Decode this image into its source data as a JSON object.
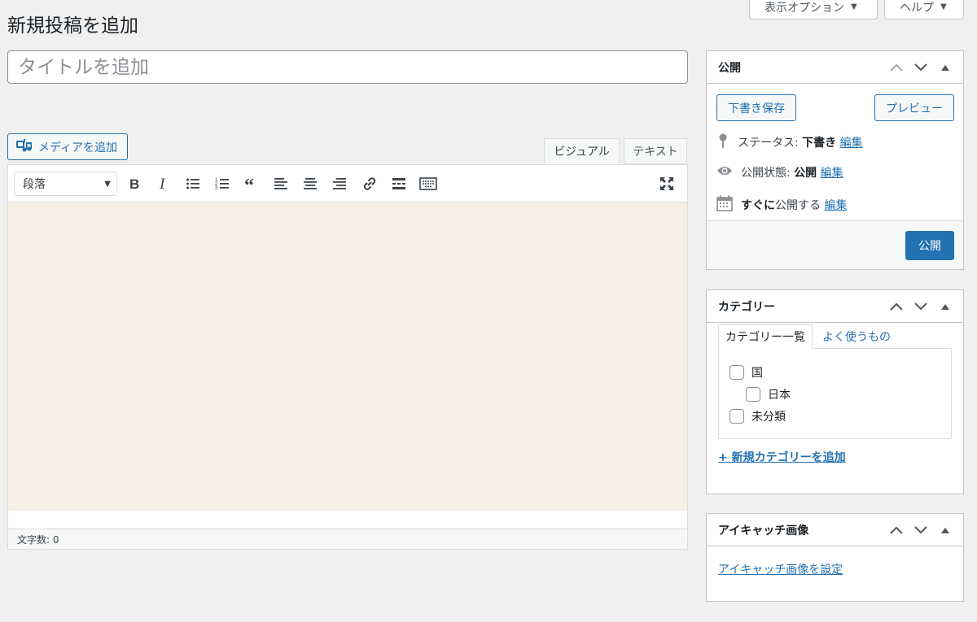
{
  "header": {
    "screen_options_label": "表示オプション",
    "help_label": "ヘルプ",
    "page_title": "新規投稿を追加"
  },
  "title_field": {
    "placeholder": "タイトルを追加"
  },
  "editor": {
    "add_media_label": "メディアを追加",
    "tabs": {
      "visual": "ビジュアル",
      "text": "テキスト"
    },
    "format_select_value": "段落",
    "word_count": "文字数: 0",
    "content_bg": "#f5efe3"
  },
  "publish_box": {
    "title": "公開",
    "save_draft_label": "下書き保存",
    "preview_label": "プレビュー",
    "status_label": "ステータス: ",
    "status_value": "下書き",
    "visibility_label": "公開状態: ",
    "visibility_value": "公開",
    "schedule_bold": "すぐに",
    "schedule_text": "公開する",
    "edit_label": "編集",
    "publish_label": "公開"
  },
  "category_box": {
    "title": "カテゴリー",
    "tab_all": "カテゴリー一覧",
    "tab_popular": "よく使うもの",
    "items": [
      {
        "label": "国",
        "checked": false
      },
      {
        "label": "日本",
        "checked": false
      },
      {
        "label": "未分類",
        "checked": false
      }
    ],
    "add_new_label": "+ 新規カテゴリーを追加"
  },
  "thumbnail_box": {
    "title": "アイキャッチ画像",
    "set_label": "アイキャッチ画像を設定"
  },
  "colors": {
    "accent": "#2271b1",
    "background": "#f0f0f1"
  }
}
